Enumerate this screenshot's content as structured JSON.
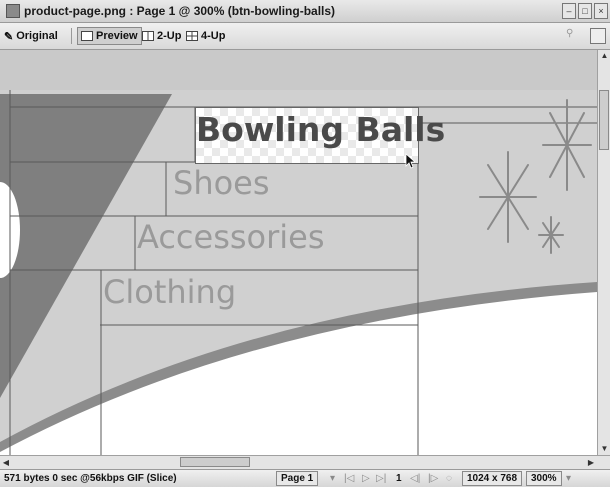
{
  "window": {
    "title": "product-page.png : Page 1 @ 300% (btn-bowling-balls)"
  },
  "toolbar": {
    "tabs": [
      {
        "label": "Original",
        "icon": "pencil-icon"
      },
      {
        "label": "Preview",
        "icon": "preview-icon",
        "active": true
      },
      {
        "label": "2-Up",
        "icon": "two-up-icon"
      },
      {
        "label": "4-Up",
        "icon": "four-up-icon"
      }
    ]
  },
  "canvas": {
    "nav": {
      "bowling_balls": "Bowling Balls",
      "shoes": "Shoes",
      "accessories": "Accessories",
      "clothing": "Clothing"
    }
  },
  "status": {
    "info": "571 bytes  0 sec @56kbps  GIF (Slice)",
    "page": "Page 1",
    "frame": "1",
    "size": "1024 x 768",
    "zoom": "300%"
  }
}
